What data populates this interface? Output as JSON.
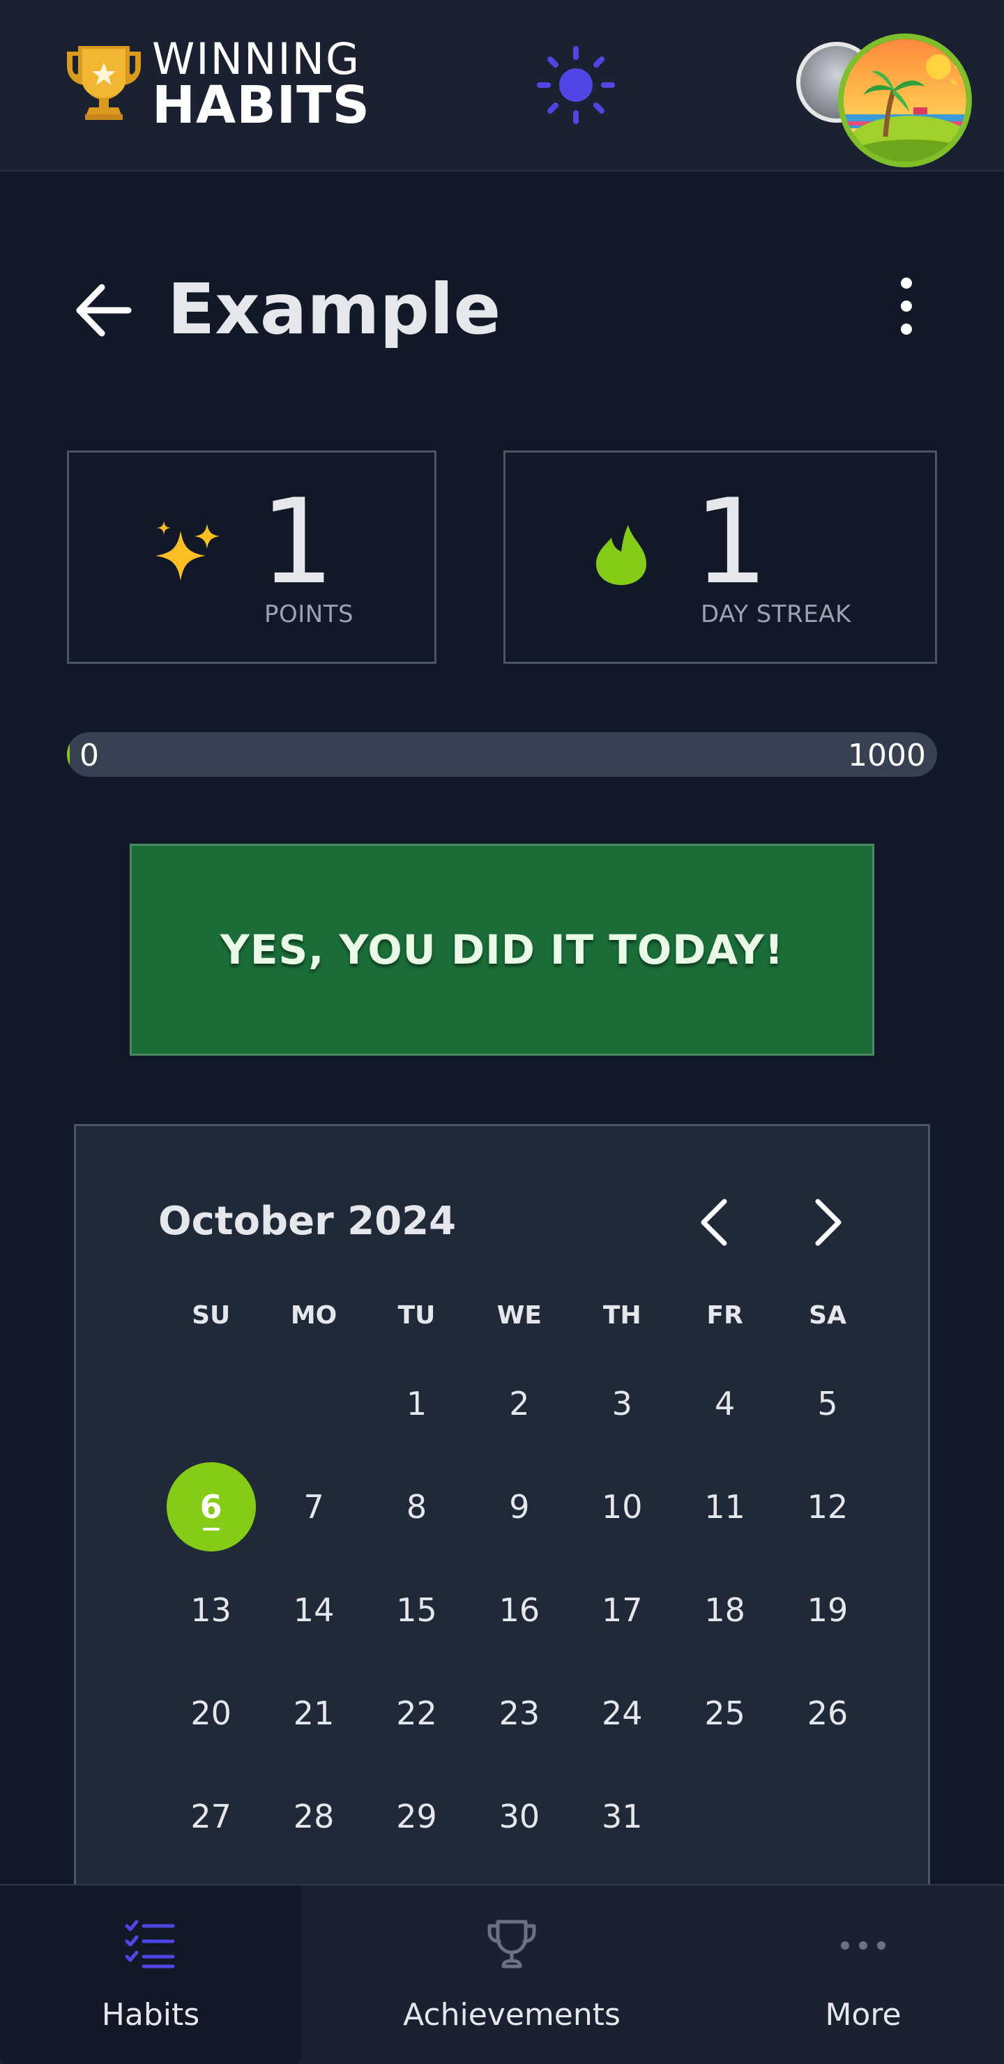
{
  "app": {
    "logo_line1": "WINNING",
    "logo_line2": "HABITS"
  },
  "header": {
    "theme_toggle_icon": "sun-icon",
    "avatar_icon": "beach-island-avatar"
  },
  "habit": {
    "title": "Example",
    "back_icon": "arrow-left-icon",
    "menu_icon": "kebab-menu-icon"
  },
  "stats": {
    "points": {
      "value": "1",
      "label": "POINTS",
      "icon": "sparkles-icon"
    },
    "streak": {
      "value": "1",
      "label": "DAY STREAK",
      "icon": "flame-icon"
    }
  },
  "progress": {
    "min_label": "0",
    "max_label": "1000",
    "value": 1,
    "max": 1000
  },
  "action": {
    "done_label": "YES, YOU DID IT TODAY!"
  },
  "calendar": {
    "month_label": "October 2024",
    "prev_icon": "chevron-left-icon",
    "next_icon": "chevron-right-icon",
    "weekdays": [
      "SU",
      "MO",
      "TU",
      "WE",
      "TH",
      "FR",
      "SA"
    ],
    "weeks": [
      [
        "",
        "",
        "1",
        "2",
        "3",
        "4",
        "5"
      ],
      [
        "6",
        "7",
        "8",
        "9",
        "10",
        "11",
        "12"
      ],
      [
        "13",
        "14",
        "15",
        "16",
        "17",
        "18",
        "19"
      ],
      [
        "20",
        "21",
        "22",
        "23",
        "24",
        "25",
        "26"
      ],
      [
        "27",
        "28",
        "29",
        "30",
        "31",
        "",
        ""
      ]
    ],
    "today": "6"
  },
  "nav": {
    "habits": {
      "label": "Habits",
      "icon": "checklist-icon"
    },
    "achievements": {
      "label": "Achievements",
      "icon": "trophy-icon"
    },
    "more": {
      "label": "More",
      "icon": "more-dots-icon"
    }
  },
  "colors": {
    "background": "#111827",
    "surface": "#1f2937",
    "accent_green": "#84cc16",
    "done_button": "#1a6d36",
    "theme_icon": "#4f46e5",
    "nav_active": "#4f46e5"
  }
}
